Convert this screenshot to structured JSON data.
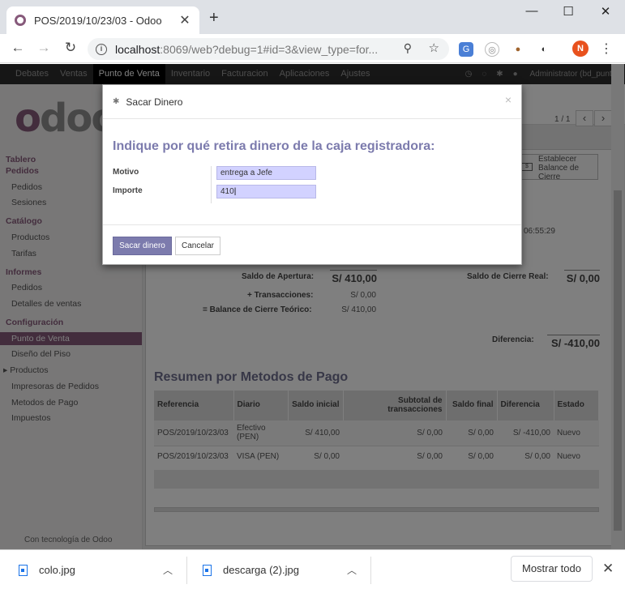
{
  "browser": {
    "tab_title": "POS/2019/10/23/03 - Odoo",
    "url_host": "localhost",
    "url_rest": ":8069/web?debug=1#id=3&view_type=for...",
    "profile_initial": "N"
  },
  "topnav": {
    "items": [
      "Debates",
      "Ventas",
      "Punto de Venta",
      "Inventario",
      "Facturacion",
      "Aplicaciones",
      "Ajustes"
    ],
    "user": "Administrator (bd_punt..."
  },
  "sidebar": {
    "sections": [
      {
        "title": "Tablero",
        "items": []
      },
      {
        "title": "Pedidos",
        "items": [
          "Pedidos",
          "Sesiones"
        ]
      },
      {
        "title": "Catálogo",
        "items": [
          "Productos",
          "Tarifas"
        ]
      },
      {
        "title": "Informes",
        "items": [
          "Pedidos",
          "Detalles de ventas"
        ]
      },
      {
        "title": "Configuración",
        "items": [
          "Punto de Venta",
          "Diseño del Piso",
          "Productos",
          "Impresoras de Pedidos",
          "Metodos de Pago",
          "Impuestos"
        ]
      }
    ],
    "footer": "Con tecnología de Odoo"
  },
  "main": {
    "pager": "1 / 1",
    "close_balance_button": "Establecer Balance de Cierre",
    "time": "06:55:29",
    "saldo_apertura_label": "Saldo de Apertura:",
    "saldo_apertura_value": "S/ 410,00",
    "transacciones_label": "+ Transacciones:",
    "transacciones_value": "S/ 0,00",
    "balance_teorico_label": "= Balance de Cierre Teórico:",
    "balance_teorico_value": "S/ 410,00",
    "saldo_cierre_label": "Saldo de Cierre Real:",
    "saldo_cierre_value": "S/ 0,00",
    "diferencia_label": "Diferencia:",
    "diferencia_value": "S/ -410,00",
    "resumen_title": "Resumen por Metodos de Pago",
    "table": {
      "headers": [
        "Referencia",
        "Diario",
        "Saldo inicial",
        "Subtotal de transacciones",
        "Saldo final",
        "Diferencia",
        "Estado"
      ],
      "rows": [
        [
          "POS/2019/10/23/03",
          "Efectivo (PEN)",
          "S/ 410,00",
          "S/ 0,00",
          "S/ 0,00",
          "S/ -410,00",
          "Nuevo"
        ],
        [
          "POS/2019/10/23/03",
          "VISA (PEN)",
          "S/ 0,00",
          "S/ 0,00",
          "S/ 0,00",
          "S/ 0,00",
          "Nuevo"
        ]
      ]
    }
  },
  "modal": {
    "title": "Sacar Dinero",
    "heading": "Indique por qué retira dinero de la caja registradora:",
    "motivo_label": "Motivo",
    "motivo_value": "entrega a Jefe",
    "importe_label": "Importe",
    "importe_value": "410",
    "primary_button": "Sacar dinero",
    "cancel_button": "Cancelar"
  },
  "downloads": {
    "items": [
      "colo.jpg",
      "descarga (2).jpg"
    ],
    "show_all": "Mostrar todo"
  },
  "colors": {
    "odoo_purple": "#875a7b",
    "modal_accent": "#7c7bad"
  }
}
